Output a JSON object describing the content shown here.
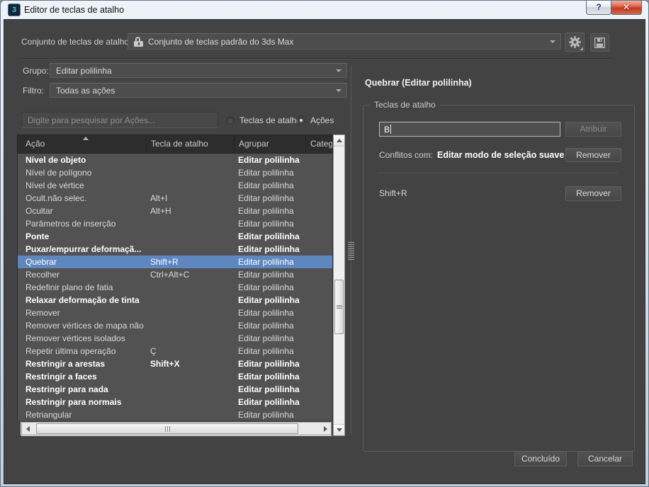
{
  "window": {
    "title": "Editor de teclas de atalho",
    "app_icon_glyph": "3",
    "help_glyph": "?",
    "close_glyph": "✕"
  },
  "toolbar": {
    "hotkey_set_label": "Conjunto de teclas de atalho:",
    "hotkey_set_value": "Conjunto de teclas padrão do 3ds Max"
  },
  "filters": {
    "group_label": "Grupo:",
    "group_value": "Editar polilinha",
    "filter_label": "Filtro:",
    "filter_value": "Todas as ações"
  },
  "search": {
    "placeholder": "Digite para pesquisar por Ações...",
    "radio_hotkeys_label": "Teclas de atalho",
    "radio_actions_label": "Ações"
  },
  "table": {
    "columns": [
      "Ação",
      "Tecla de atalho",
      "Agrupar",
      "Categoria"
    ],
    "rows": [
      {
        "action": "Nível de objeto",
        "shortcut": "",
        "group": "Editar polilinha",
        "bold": true,
        "selected": false
      },
      {
        "action": "Nível de polígono",
        "shortcut": "",
        "group": "Editar polilinha",
        "bold": false,
        "selected": false
      },
      {
        "action": "Nível de vértice",
        "shortcut": "",
        "group": "Editar polilinha",
        "bold": false,
        "selected": false
      },
      {
        "action": "Ocult.não selec.",
        "shortcut": "Alt+I",
        "group": "Editar polilinha",
        "bold": false,
        "selected": false
      },
      {
        "action": "Ocultar",
        "shortcut": "Alt+H",
        "group": "Editar polilinha",
        "bold": false,
        "selected": false
      },
      {
        "action": "Parâmetros de inserção",
        "shortcut": "",
        "group": "Editar polilinha",
        "bold": false,
        "selected": false
      },
      {
        "action": "Ponte",
        "shortcut": "",
        "group": "Editar polilinha",
        "bold": true,
        "selected": false
      },
      {
        "action": "Puxar/empurrar deformaçã...",
        "shortcut": "",
        "group": "Editar polilinha",
        "bold": true,
        "selected": false
      },
      {
        "action": "Quebrar",
        "shortcut": "Shift+R",
        "group": "Editar polilinha",
        "bold": false,
        "selected": true
      },
      {
        "action": "Recolher",
        "shortcut": "Ctrl+Alt+C",
        "group": "Editar polilinha",
        "bold": false,
        "selected": false
      },
      {
        "action": "Redefinir plano de fatia",
        "shortcut": "",
        "group": "Editar polilinha",
        "bold": false,
        "selected": false
      },
      {
        "action": "Relaxar deformação de tinta",
        "shortcut": "",
        "group": "Editar polilinha",
        "bold": true,
        "selected": false
      },
      {
        "action": "Remover",
        "shortcut": "",
        "group": "Editar polilinha",
        "bold": false,
        "selected": false
      },
      {
        "action": "Remover vértices de mapa não u...",
        "shortcut": "",
        "group": "Editar polilinha",
        "bold": false,
        "selected": false
      },
      {
        "action": "Remover vértices isolados",
        "shortcut": "",
        "group": "Editar polilinha",
        "bold": false,
        "selected": false
      },
      {
        "action": "Repetir última operação",
        "shortcut": "Ç",
        "group": "Editar polilinha",
        "bold": false,
        "selected": false
      },
      {
        "action": "Restringir a arestas",
        "shortcut": "Shift+X",
        "group": "Editar polilinha",
        "bold": true,
        "selected": false
      },
      {
        "action": "Restringir a faces",
        "shortcut": "",
        "group": "Editar polilinha",
        "bold": true,
        "selected": false
      },
      {
        "action": "Restringir para nada",
        "shortcut": "",
        "group": "Editar polilinha",
        "bold": true,
        "selected": false
      },
      {
        "action": "Restringir para normais",
        "shortcut": "",
        "group": "Editar polilinha",
        "bold": true,
        "selected": false
      },
      {
        "action": "Retriangular",
        "shortcut": "",
        "group": "Editar polilinha",
        "bold": false,
        "selected": false
      }
    ]
  },
  "details": {
    "heading": "Quebrar (Editar polilinha)",
    "groupbox_label": "Teclas de atalho",
    "hotkey_input_value": "B",
    "assign_label": "Atribuir",
    "conflicts_label": "Conflitos com:",
    "conflicts_value": "Editar modo de seleção suave",
    "remove_label": "Remover",
    "assigned_shortcut": "Shift+R",
    "remove2_label": "Remover"
  },
  "footer": {
    "done_label": "Concluído",
    "cancel_label": "Cancelar"
  },
  "colors": {
    "selection_blue": "#5e87c0",
    "content_bg": "#434343",
    "table_bg": "#525252",
    "header_bg": "#2d2d2d",
    "titlebar_close_red": "#c03a22",
    "accent_teal": "#2fd6c2"
  }
}
